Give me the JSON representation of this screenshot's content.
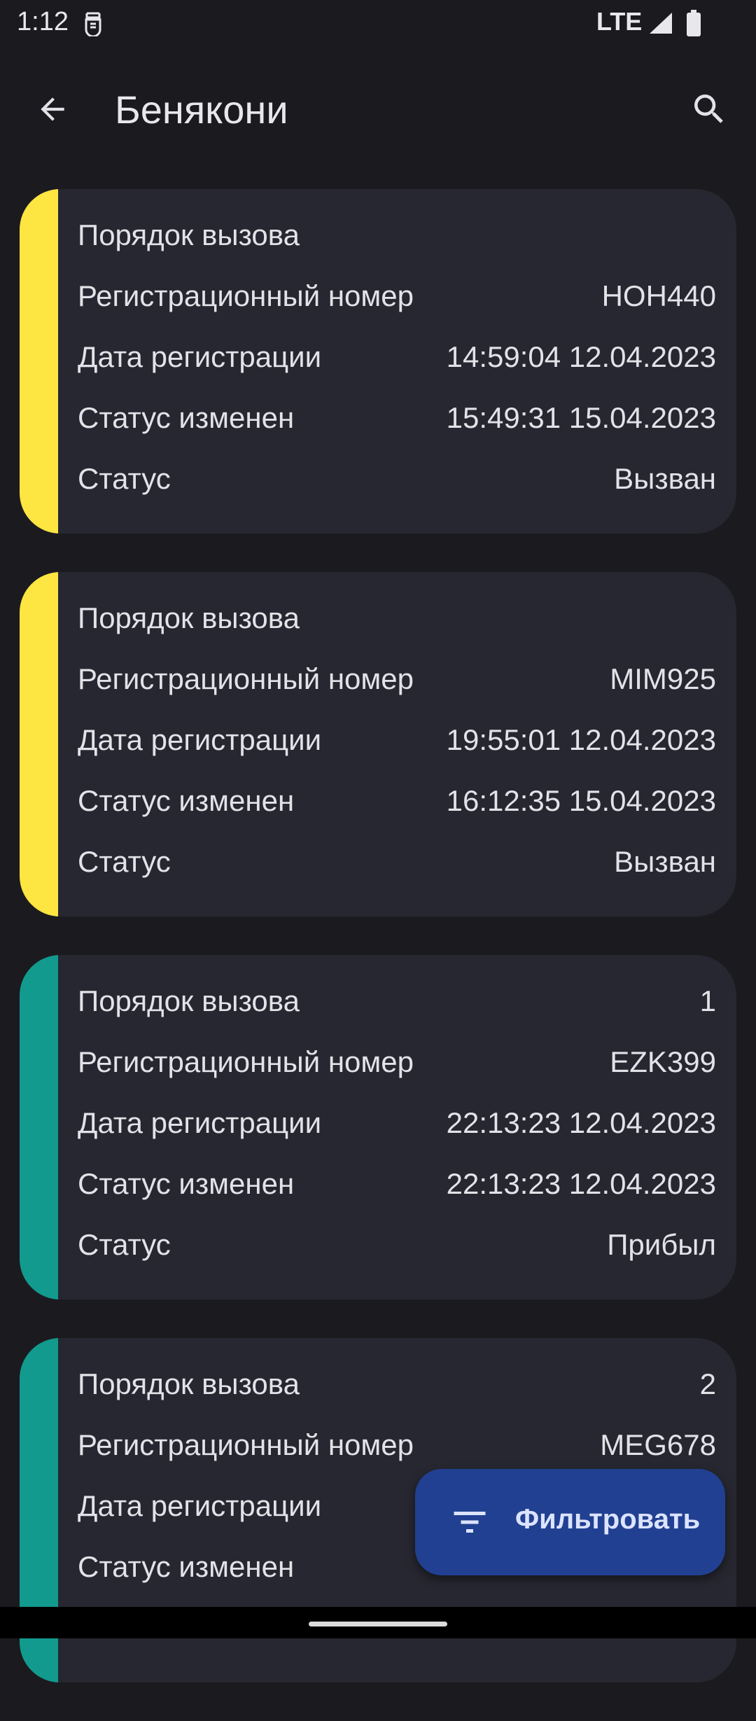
{
  "status_bar": {
    "time": "1:12",
    "network": "LTE",
    "icons": [
      "notification-icon",
      "signal-icon",
      "battery-icon"
    ]
  },
  "app_bar": {
    "title": "Бенякони",
    "back_icon": "arrow-back-icon",
    "search_icon": "search-icon"
  },
  "colors": {
    "background": "#1b1b1f",
    "card": "#262730",
    "stripe_called": "#fde542",
    "stripe_arrived": "#129a8e",
    "fab": "#214091"
  },
  "cards": [
    {
      "stripe_color": "#fde542",
      "rows": [
        {
          "label": "Порядок вызова",
          "value": ""
        },
        {
          "label": "Регистрационный номер",
          "value": "HOH440"
        },
        {
          "label": "Дата регистрации",
          "value": "14:59:04 12.04.2023"
        },
        {
          "label": "Статус изменен",
          "value": "15:49:31 15.04.2023"
        },
        {
          "label": "Статус",
          "value": "Вызван"
        }
      ]
    },
    {
      "stripe_color": "#fde542",
      "rows": [
        {
          "label": "Порядок вызова",
          "value": ""
        },
        {
          "label": "Регистрационный номер",
          "value": "MIM925"
        },
        {
          "label": "Дата регистрации",
          "value": "19:55:01 12.04.2023"
        },
        {
          "label": "Статус изменен",
          "value": "16:12:35 15.04.2023"
        },
        {
          "label": "Статус",
          "value": "Вызван"
        }
      ]
    },
    {
      "stripe_color": "#129a8e",
      "rows": [
        {
          "label": "Порядок вызова",
          "value": "1"
        },
        {
          "label": "Регистрационный номер",
          "value": "EZK399"
        },
        {
          "label": "Дата регистрации",
          "value": "22:13:23 12.04.2023"
        },
        {
          "label": "Статус изменен",
          "value": "22:13:23 12.04.2023"
        },
        {
          "label": "Статус",
          "value": "Прибыл"
        }
      ]
    },
    {
      "stripe_color": "#129a8e",
      "rows": [
        {
          "label": "Порядок вызова",
          "value": "2"
        },
        {
          "label": "Регистрационный номер",
          "value": "MEG678"
        },
        {
          "label": "Дата регистрации",
          "value": ""
        },
        {
          "label": "Статус изменен",
          "value": ""
        }
      ]
    }
  ],
  "fab": {
    "label": "Фильтровать",
    "icon": "filter-icon"
  }
}
